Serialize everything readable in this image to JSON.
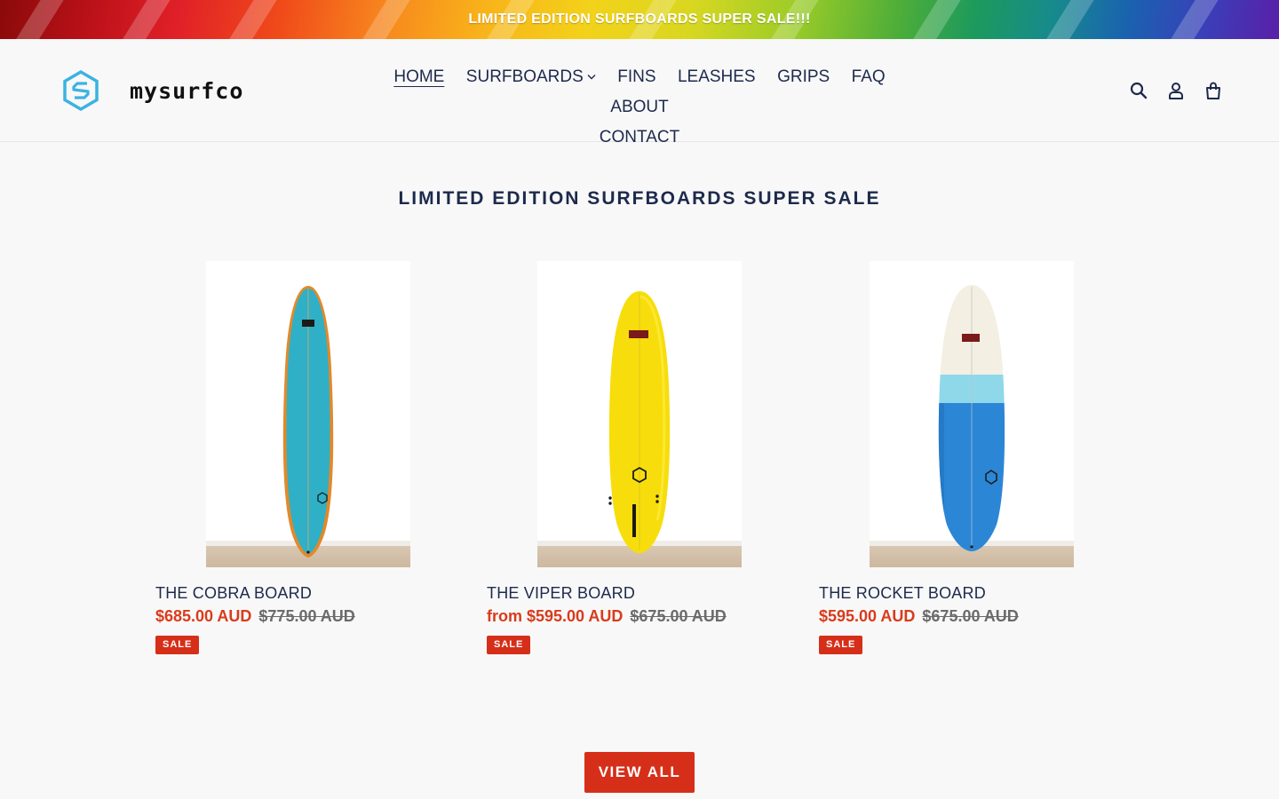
{
  "announcement": {
    "text": "LIMITED EDITION SURFBOARDS SUPER SALE!!!"
  },
  "brand": {
    "name": "mysurfco",
    "logo_color": "#3bb3e0"
  },
  "nav": {
    "items": [
      {
        "label": "HOME",
        "active": true
      },
      {
        "label": "SURFBOARDS",
        "has_dropdown": true
      },
      {
        "label": "FINS"
      },
      {
        "label": "LEASHES"
      },
      {
        "label": "GRIPS"
      },
      {
        "label": "FAQ"
      },
      {
        "label": "ABOUT"
      },
      {
        "label": "CONTACT"
      }
    ]
  },
  "header_icons": [
    "search-icon",
    "account-icon",
    "cart-icon"
  ],
  "section": {
    "title": "LIMITED EDITION SURFBOARDS SUPER SALE"
  },
  "products": [
    {
      "title": "THE COBRA BOARD",
      "sale_price": "$685.00 AUD",
      "original_price": "$775.00 AUD",
      "badge": "SALE",
      "board_color": "#2fb0c6",
      "rail_color": "#e2892a"
    },
    {
      "title": "THE VIPER BOARD",
      "sale_price": "from $595.00 AUD",
      "original_price": "$675.00 AUD",
      "badge": "SALE",
      "board_color": "#f7dd0c",
      "rail_color": "#f0cf00"
    },
    {
      "title": "THE ROCKET BOARD",
      "sale_price": "$595.00 AUD",
      "original_price": "$675.00 AUD",
      "badge": "SALE",
      "board_color": "#2b86d6",
      "rail_color": "#f3efe2"
    }
  ],
  "view_all_label": "VIEW ALL",
  "colors": {
    "accent": "#d62f19",
    "sale_text": "#d93b1c",
    "nav_text": "#1d2a4c",
    "background": "#f8f8f8"
  }
}
